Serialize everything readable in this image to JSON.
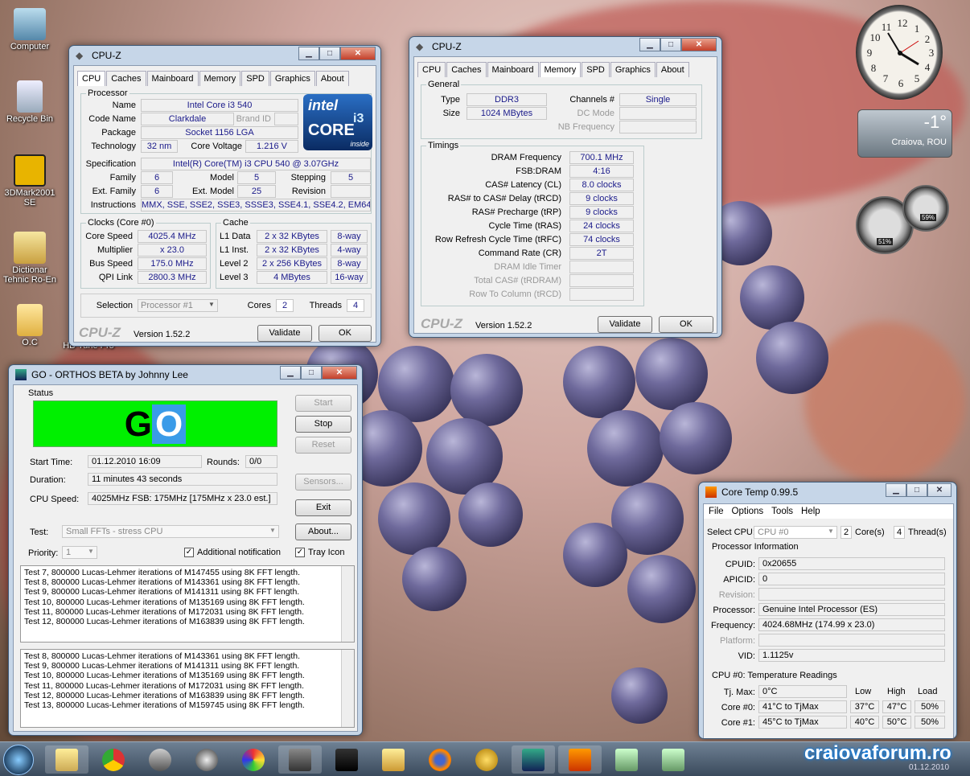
{
  "desktop": {
    "icons": [
      "Computer",
      "Recycle Bin",
      "3DMark2001 SE",
      "Dictionar Tehnic Ro-En",
      "O.C"
    ],
    "partial_label": "HD Tune Pro"
  },
  "clock": {
    "numbers": [
      "12",
      "1",
      "2",
      "3",
      "4",
      "5",
      "6",
      "7",
      "8",
      "9",
      "10",
      "11"
    ]
  },
  "weather": {
    "temp": "-1°",
    "city": "Craiova, ROU"
  },
  "meter": {
    "cpu": "51%",
    "mem": "59%"
  },
  "cpuz_cpu": {
    "title": "CPU-Z",
    "tabs": [
      "CPU",
      "Caches",
      "Mainboard",
      "Memory",
      "SPD",
      "Graphics",
      "About"
    ],
    "processor": {
      "group": "Processor",
      "name_l": "Name",
      "name": "Intel Core i3 540",
      "codename_l": "Code Name",
      "codename": "Clarkdale",
      "brandid_l": "Brand ID",
      "package_l": "Package",
      "package": "Socket 1156 LGA",
      "tech_l": "Technology",
      "tech": "32 nm",
      "cv_l": "Core Voltage",
      "cv": "1.216 V",
      "spec_l": "Specification",
      "spec": "Intel(R) Core(TM) i3 CPU     540  @ 3.07GHz",
      "family_l": "Family",
      "family": "6",
      "model_l": "Model",
      "model": "5",
      "stepping_l": "Stepping",
      "stepping": "5",
      "extfam_l": "Ext. Family",
      "extfam": "6",
      "extmodel_l": "Ext. Model",
      "extmodel": "25",
      "revision_l": "Revision",
      "instr_l": "Instructions",
      "instr": "MMX, SSE, SSE2, SSE3, SSSE3, SSE4.1, SSE4.2, EM64T"
    },
    "logo": {
      "brand": "intel",
      "line1": "CORE",
      "line2": "i3",
      "inside": "inside"
    },
    "clocks": {
      "group": "Clocks (Core #0)",
      "cs_l": "Core Speed",
      "cs": "4025.4 MHz",
      "mult_l": "Multiplier",
      "mult": "x 23.0",
      "bus_l": "Bus Speed",
      "bus": "175.0 MHz",
      "qpi_l": "QPI Link",
      "qpi": "2800.3 MHz"
    },
    "cache": {
      "group": "Cache",
      "rows": [
        {
          "l": "L1 Data",
          "v": "2 x 32 KBytes",
          "w": "8-way"
        },
        {
          "l": "L1 Inst.",
          "v": "2 x 32 KBytes",
          "w": "4-way"
        },
        {
          "l": "Level 2",
          "v": "2 x 256 KBytes",
          "w": "8-way"
        },
        {
          "l": "Level 3",
          "v": "4 MBytes",
          "w": "16-way"
        }
      ]
    },
    "sel_l": "Selection",
    "sel": "Processor #1",
    "cores_l": "Cores",
    "cores": "2",
    "threads_l": "Threads",
    "threads": "4",
    "brand": "CPU-Z",
    "version": "Version 1.52.2",
    "validate": "Validate",
    "ok": "OK"
  },
  "cpuz_mem": {
    "title": "CPU-Z",
    "tabs": [
      "CPU",
      "Caches",
      "Mainboard",
      "Memory",
      "SPD",
      "Graphics",
      "About"
    ],
    "general": "General",
    "type_l": "Type",
    "type": "DDR3",
    "size_l": "Size",
    "size": "1024 MBytes",
    "ch_l": "Channels #",
    "ch": "Single",
    "dc_l": "DC Mode",
    "nb_l": "NB Frequency",
    "timings": "Timings",
    "rows": [
      {
        "l": "DRAM Frequency",
        "v": "700.1 MHz"
      },
      {
        "l": "FSB:DRAM",
        "v": "4:16"
      },
      {
        "l": "CAS# Latency (CL)",
        "v": "8.0 clocks"
      },
      {
        "l": "RAS# to CAS# Delay (tRCD)",
        "v": "9 clocks"
      },
      {
        "l": "RAS# Precharge (tRP)",
        "v": "9 clocks"
      },
      {
        "l": "Cycle Time (tRAS)",
        "v": "24 clocks"
      },
      {
        "l": "Row Refresh Cycle Time (tRFC)",
        "v": "74 clocks"
      },
      {
        "l": "Command Rate (CR)",
        "v": "2T"
      },
      {
        "l": "DRAM Idle Timer",
        "v": ""
      },
      {
        "l": "Total CAS# (tRDRAM)",
        "v": ""
      },
      {
        "l": "Row To Column (tRCD)",
        "v": ""
      }
    ],
    "brand": "CPU-Z",
    "version": "Version 1.52.2",
    "validate": "Validate",
    "ok": "OK"
  },
  "orthos": {
    "title": "GO - ORTHOS BETA by Johnny Lee",
    "status": "Status",
    "go1": "G",
    "go2": "O",
    "start": "Start",
    "stop": "Stop",
    "reset": "Reset",
    "sensors": "Sensors...",
    "exit": "Exit",
    "about": "About...",
    "st_l": "Start Time:",
    "st": "01.12.2010 16:09",
    "rounds_l": "Rounds:",
    "rounds": "0/0",
    "dur_l": "Duration:",
    "dur": "11 minutes 43 seconds",
    "speed_l": "CPU Speed:",
    "speed": "4025MHz FSB: 175MHz [175MHz x 23.0 est.]",
    "test_l": "Test:",
    "test": "Small FFTs - stress CPU",
    "prio_l": "Priority:",
    "prio": "1",
    "notif": "Additional notification",
    "tray": "Tray Icon",
    "log1": [
      "Test 7, 800000 Lucas-Lehmer iterations of M147455 using 8K FFT length.",
      "Test 8, 800000 Lucas-Lehmer iterations of M143361 using 8K FFT length.",
      "Test 9, 800000 Lucas-Lehmer iterations of M141311 using 8K FFT length.",
      "Test 10, 800000 Lucas-Lehmer iterations of M135169 using 8K FFT length.",
      "Test 11, 800000 Lucas-Lehmer iterations of M172031 using 8K FFT length.",
      "Test 12, 800000 Lucas-Lehmer iterations of M163839 using 8K FFT length."
    ],
    "log2": [
      "Test 8, 800000 Lucas-Lehmer iterations of M143361 using 8K FFT length.",
      "Test 9, 800000 Lucas-Lehmer iterations of M141311 using 8K FFT length.",
      "Test 10, 800000 Lucas-Lehmer iterations of M135169 using 8K FFT length.",
      "Test 11, 800000 Lucas-Lehmer iterations of M172031 using 8K FFT length.",
      "Test 12, 800000 Lucas-Lehmer iterations of M163839 using 8K FFT length.",
      "Test 13, 800000 Lucas-Lehmer iterations of M159745 using 8K FFT length."
    ]
  },
  "coretemp": {
    "title": "Core Temp 0.99.5",
    "menu": [
      "File",
      "Options",
      "Tools",
      "Help"
    ],
    "sel_l": "Select CPU:",
    "sel": "CPU #0",
    "cores": "2",
    "cores_l": "Core(s)",
    "threads": "4",
    "threads_l": "Thread(s)",
    "pi": "Processor Information",
    "rows": [
      {
        "l": "CPUID:",
        "v": "0x20655",
        "d": false
      },
      {
        "l": "APICID:",
        "v": "0",
        "d": false
      },
      {
        "l": "Revision:",
        "v": "",
        "d": true
      },
      {
        "l": "Processor:",
        "v": "Genuine Intel Processor (ES)",
        "d": false
      },
      {
        "l": "Frequency:",
        "v": "4024.68MHz (174.99 x 23.0)",
        "d": false
      },
      {
        "l": "Platform:",
        "v": "",
        "d": true
      },
      {
        "l": "VID:",
        "v": "1.1125v",
        "d": false
      }
    ],
    "temps": "CPU #0: Temperature Readings",
    "h_low": "Low",
    "h_high": "High",
    "h_load": "Load",
    "tj_l": "Tj. Max:",
    "tj": "0°C",
    "cores_t": [
      {
        "l": "Core #0:",
        "v": "41°C to TjMax",
        "low": "37°C",
        "high": "47°C",
        "load": "50%"
      },
      {
        "l": "Core #1:",
        "v": "45°C to TjMax",
        "low": "40°C",
        "high": "50°C",
        "load": "50%"
      }
    ]
  },
  "watermark": "craiovaforum.ro",
  "date": "01.12.2010"
}
